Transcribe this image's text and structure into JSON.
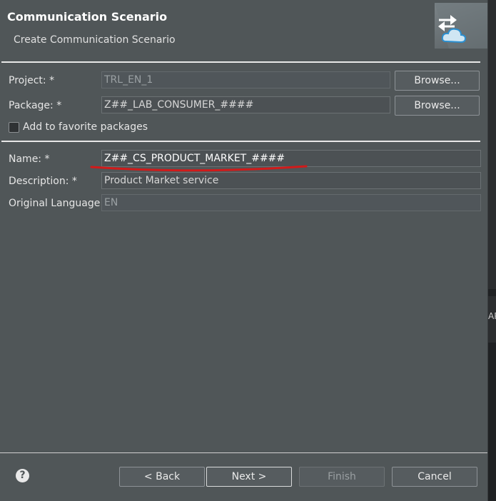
{
  "header": {
    "title": "Communication Scenario",
    "subtitle": "Create Communication Scenario"
  },
  "project": {
    "label": "Project: *",
    "value": "TRL_EN_1",
    "browse": "Browse..."
  },
  "package": {
    "label": "Package: *",
    "value": "Z##_LAB_CONSUMER_####",
    "browse": "Browse..."
  },
  "favorite": {
    "label": "Add to favorite packages",
    "checked": false
  },
  "name": {
    "label": "Name: *",
    "value": "Z##_CS_PRODUCT_MARKET_####"
  },
  "description": {
    "label": "Description: *",
    "value": "Product Market service"
  },
  "language": {
    "label": "Original Language:",
    "value": "EN"
  },
  "footer": {
    "help": "?",
    "back": "< Back",
    "next": "Next >",
    "finish": "Finish",
    "cancel": "Cancel"
  },
  "background": {
    "edge_text": "AP"
  },
  "colors": {
    "annotation_underline": "#d11a1a",
    "dialog_bg": "#505658"
  }
}
